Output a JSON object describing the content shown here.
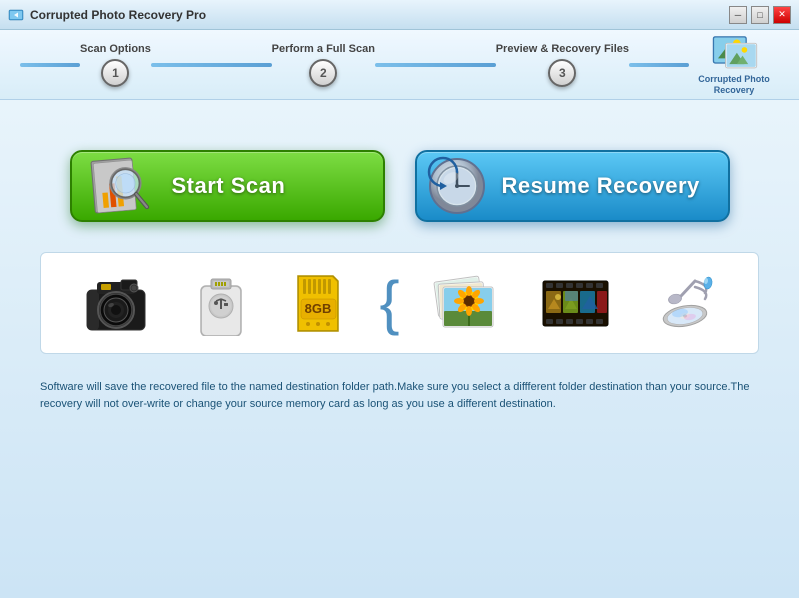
{
  "app": {
    "title": "Corrupted Photo Recovery Pro",
    "logo_line1": "Corrupted Photo",
    "logo_line2": "Recovery"
  },
  "titlebar": {
    "minimize_label": "─",
    "maximize_label": "□",
    "close_label": "✕"
  },
  "steps": {
    "step1_label": "Scan Options",
    "step1_number": "1",
    "step2_label": "Perform a Full Scan",
    "step2_number": "2",
    "step3_label": "Preview & Recovery Files",
    "step3_number": "3"
  },
  "buttons": {
    "scan_label": "Start Scan",
    "resume_label": "Resume Recovery"
  },
  "footer": {
    "text": "Software will save the recovered file to the named destination folder path.Make sure you select a diffferent folder destination than your source.The recovery will not over-write or change your source memory card as long as you use a different destination."
  },
  "icons": {
    "brace": "{"
  }
}
